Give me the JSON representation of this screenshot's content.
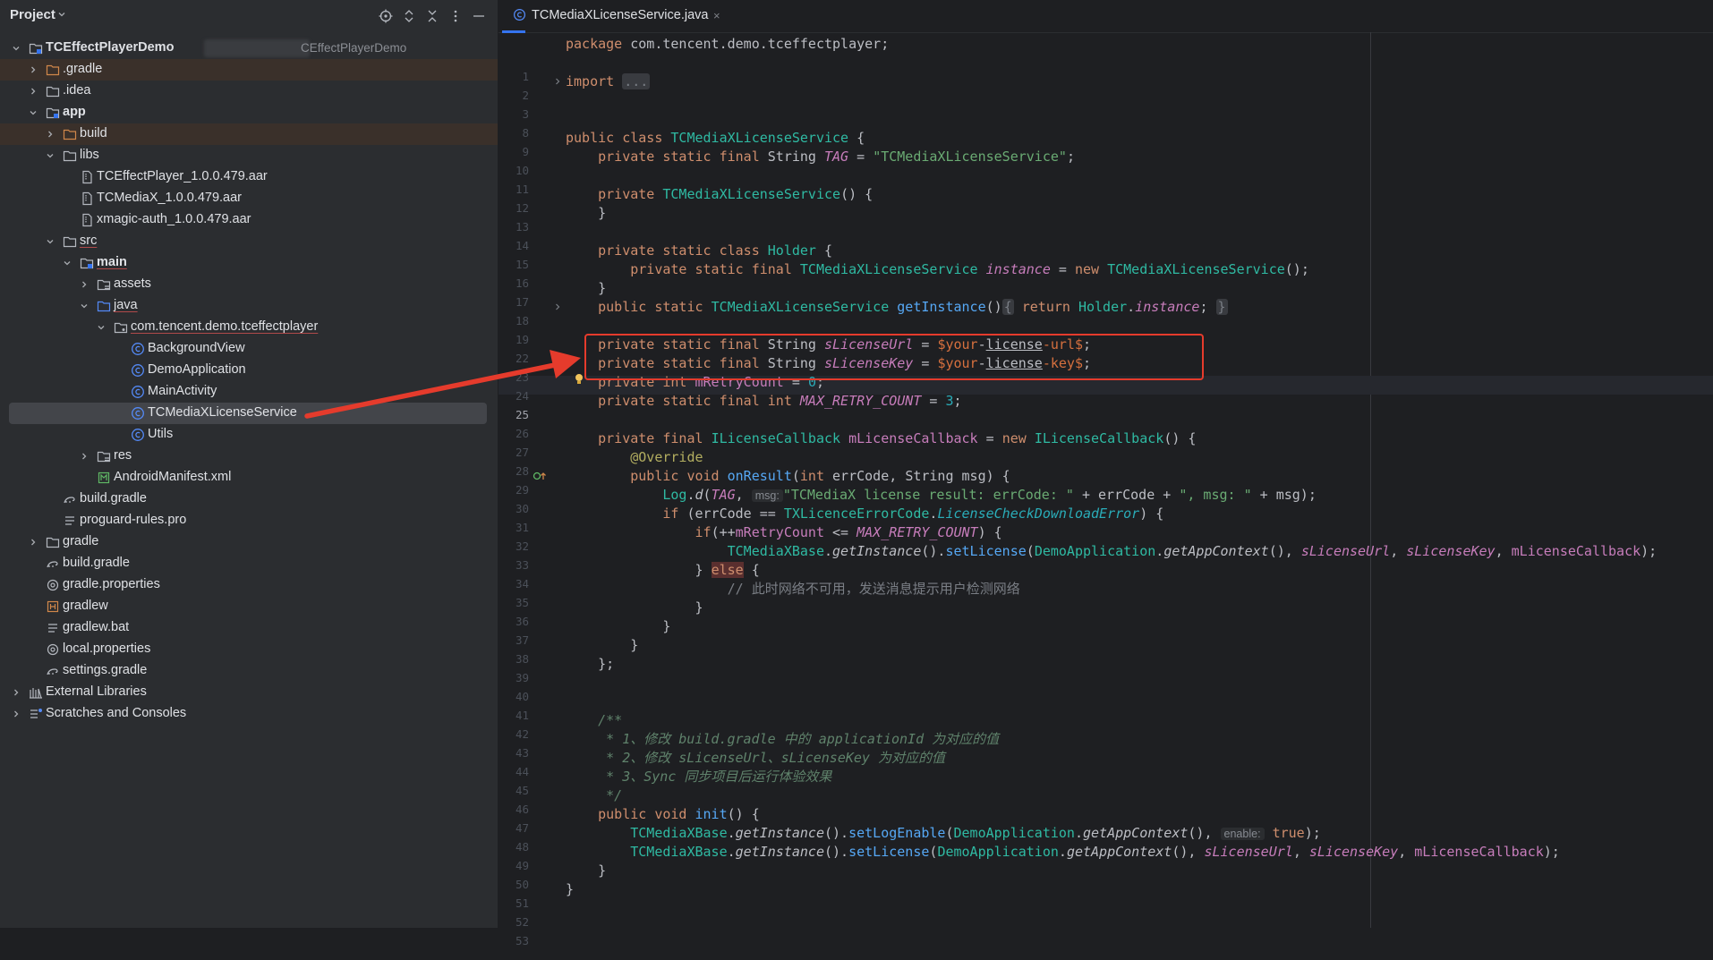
{
  "panel": {
    "title": "Project"
  },
  "tree": [
    {
      "label": "TCEffectPlayerDemo",
      "path": "CEffectPlayerDemo"
    },
    {
      "label": ".gradle"
    },
    {
      "label": ".idea"
    },
    {
      "label": "app"
    },
    {
      "label": "build"
    },
    {
      "label": "libs"
    },
    {
      "label": "TCEffectPlayer_1.0.0.479.aar"
    },
    {
      "label": "TCMediaX_1.0.0.479.aar"
    },
    {
      "label": "xmagic-auth_1.0.0.479.aar"
    },
    {
      "label": "src"
    },
    {
      "label": "main"
    },
    {
      "label": "assets"
    },
    {
      "label": "java"
    },
    {
      "label": "com.tencent.demo.tceffectplayer"
    },
    {
      "label": "BackgroundView"
    },
    {
      "label": "DemoApplication"
    },
    {
      "label": "MainActivity"
    },
    {
      "label": "TCMediaXLicenseService"
    },
    {
      "label": "Utils"
    },
    {
      "label": "res"
    },
    {
      "label": "AndroidManifest.xml"
    },
    {
      "label": "build.gradle"
    },
    {
      "label": "proguard-rules.pro"
    },
    {
      "label": "gradle"
    },
    {
      "label": "build.gradle"
    },
    {
      "label": "gradle.properties"
    },
    {
      "label": "gradlew"
    },
    {
      "label": "gradlew.bat"
    },
    {
      "label": "local.properties"
    },
    {
      "label": "settings.gradle"
    },
    {
      "label": "External Libraries"
    },
    {
      "label": "Scratches and Consoles"
    }
  ],
  "editor": {
    "tab_label": "TCMediaXLicenseService.java",
    "tab_close": "×",
    "line_numbers": [
      "1",
      "2",
      "3",
      "8",
      "9",
      "10",
      "11",
      "12",
      "13",
      "14",
      "15",
      "16",
      "17",
      "18",
      "19",
      "22",
      "23",
      "24",
      "25",
      "26",
      "27",
      "28",
      "29",
      "30",
      "31",
      "32",
      "33",
      "34",
      "35",
      "36",
      "37",
      "38",
      "39",
      "40",
      "41",
      "42",
      "43",
      "44",
      "45",
      "46",
      "47",
      "48",
      "49",
      "50",
      "51",
      "52",
      "53"
    ],
    "current_line": "25",
    "code": {
      "l1_kw": "package",
      "l1_rest": " com.tencent.demo.tceffectplayer;",
      "l3_kw": "import",
      "l3_fold": "...",
      "l10_kw": "public class",
      "l10_cls": "TCMediaXLicenseService",
      "l10_rest": " {",
      "l11_kw": "private static final",
      "l11_ty": " String ",
      "l11_fld": "TAG",
      "l11_eq": " = ",
      "l11_str": "\"TCMediaXLicenseService\"",
      "l11_end": ";",
      "l13_kw": "private",
      "l13_cls": "TCMediaXLicenseService",
      "l13_rest": "() {",
      "close_brace": "}",
      "l16_kw": "private static class",
      "l16_cls": "Holder",
      "l16_rest": " {",
      "l17_kw": "private static final",
      "l17_cls": "TCMediaXLicenseService",
      "l17_fld": "instance",
      "l17_eq": " = ",
      "l17_new": "new",
      "l17_cls2": "TCMediaXLicenseService",
      "l17_end": "();",
      "l19_kw": "public static",
      "l19_cls": "TCMediaXLicenseService",
      "l19_mth": "getInstance",
      "l19_p": "()",
      "l19_fold1": "{",
      "l19_ret": "return",
      "l19_holder": "Holder",
      "l19_dot": ".",
      "l19_inst": "instance",
      "l19_semi": ";",
      "l19_fold2": "}",
      "l23_kw": "private static final",
      "l23_ty": " String ",
      "l23_fld": "sLicenseUrl",
      "l23_eq": " = ",
      "l23_t1": "$your",
      "l23_t2": "-",
      "l23_t3": "license",
      "l23_t4": "-url$",
      "l24_kw": "private static final",
      "l24_ty": " String ",
      "l24_fld": "sLicenseKey",
      "l24_eq": " = ",
      "l24_t1": "$your",
      "l24_t2": "-",
      "l24_t3": "license",
      "l24_t4": "-key$",
      "semi": ";",
      "l25_kw": "private int",
      "l25_fld": "mRetryCount",
      "l25_eq": " = ",
      "l25_num": "0",
      "l26_kw": "private static final int",
      "l26_fld": "MAX_RETRY_COUNT",
      "l26_eq": " = ",
      "l26_num": "3",
      "l28_kw": "private final",
      "l28_cls": "ILicenseCallback",
      "l28_fld": "mLicenseCallback",
      "l28_eq": " = ",
      "l28_new": "new",
      "l28_cls2": "ILicenseCallback",
      "l28_rest": "() {",
      "l29_ann": "@Override",
      "l30_kw": "public void",
      "l30_mth": "onResult",
      "l30_p1": "(",
      "l30_int": "int",
      "l30_a1": " errCode, ",
      "l30_str": "String",
      "l30_a2": " msg) {",
      "l31_cls": "Log",
      "l31_dot": ".",
      "l31_mth": "d",
      "l31_p": "(",
      "l31_tag": "TAG",
      "l31_c": ", ",
      "l31_hint": "msg:",
      "l31_str1": "\"TCMediaX license result: errCode: \"",
      "l31_p2": " + errCode + ",
      "l31_str2": "\", msg: \"",
      "l31_p3": " + msg);",
      "l32_kw": "if",
      "l32_p1": " (errCode == ",
      "l32_cls": "TXLicenceErrorCode",
      "l32_dot": ".",
      "l32_fld": "LicenseCheckDownloadError",
      "l32_p2": ") {",
      "l33_kw": "if",
      "l33_p1": "(++",
      "l33_fld": "mRetryCount",
      "l33_p2": " <= ",
      "l33_max": "MAX_RETRY_COUNT",
      "l33_p3": ") {",
      "l34_cls": "TCMediaXBase",
      "l34_dot": ".",
      "l34_gi": "getInstance",
      "l34_p": "().",
      "l34_sl": "setLicense",
      "l34_p2": "(",
      "l34_da": "DemoApplication",
      "l34_dot2": ".",
      "l34_gac": "getAppContext",
      "l34_p3": "(), ",
      "l34_f1": "sLicenseUrl",
      "l34_c": ", ",
      "l34_f2": "sLicenseKey",
      "l34_c2": ", ",
      "l34_f3": "mLicenseCallback",
      "l34_end": ");",
      "l35_b": "} ",
      "l35_kw": "else",
      "l35_rest": " {",
      "l36_cmt": "// 此时网络不可用，发送消息提示用户检测网络",
      "l40_end": "};",
      "l43": "/**",
      "l44": " * 1、修改 build.gradle 中的 applicationId 为对应的值",
      "l45": " * 2、修改 sLicenseUrl、sLicenseKey 为对应的值",
      "l46": " * 3、Sync 同步项目后运行体验效果",
      "l47": " */",
      "l48_kw": "public void",
      "l48_mth": "init",
      "l48_rest": "() {",
      "l49_cls": "TCMediaXBase",
      "l49_dot": ".",
      "l49_gi": "getInstance",
      "l49_p": "().",
      "l49_m": "setLogEnable",
      "l49_p2": "(",
      "l49_da": "DemoApplication",
      "l49_gac": "getAppContext",
      "l49_p3": "(), ",
      "l49_hint": "enable:",
      "l49_true": "true",
      "l49_end": ");",
      "l50_sl": "setLicense",
      "l50_f1": "sLicenseUrl",
      "l50_f2": "sLicenseKey",
      "l50_f3": "mLicenseCallback"
    }
  }
}
